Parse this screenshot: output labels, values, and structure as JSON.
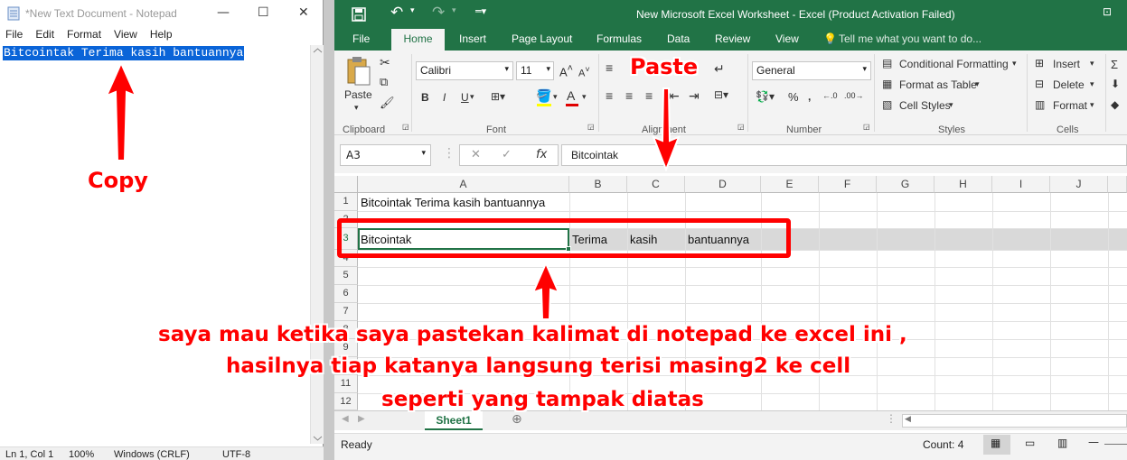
{
  "notepad": {
    "title": "*New Text Document - Notepad",
    "menu": [
      "File",
      "Edit",
      "Format",
      "View",
      "Help"
    ],
    "content": "Bitcointak Terima kasih bantuannya",
    "status": {
      "position": "Ln 1, Col 1",
      "zoom": "100%",
      "line_ending": "Windows (CRLF)",
      "encoding": "UTF-8"
    }
  },
  "excel": {
    "title": "New Microsoft Excel Worksheet - Excel (Product Activation Failed)",
    "tabs": [
      "File",
      "Home",
      "Insert",
      "Page Layout",
      "Formulas",
      "Data",
      "Review",
      "View"
    ],
    "tell_me": "Tell me what you want to do...",
    "ribbon": {
      "paste": "Paste",
      "font_name": "Calibri",
      "font_size": "11",
      "number_format": "General",
      "conditional_formatting": "Conditional Formatting",
      "format_as_table": "Format as Table",
      "cell_styles": "Cell Styles",
      "insert": "Insert",
      "delete": "Delete",
      "format": "Format",
      "groups": {
        "clipboard": "Clipboard",
        "font": "Font",
        "alignment": "Alignment",
        "number": "Number",
        "styles": "Styles",
        "cells": "Cells"
      }
    },
    "name_box": "A3",
    "formula": "Bitcointak",
    "columns": [
      "A",
      "B",
      "C",
      "D",
      "E",
      "F",
      "G",
      "H",
      "I",
      "J"
    ],
    "rows": [
      "1",
      "2",
      "3",
      "4",
      "5",
      "6",
      "7",
      "8",
      "9",
      "10",
      "11",
      "12"
    ],
    "cells": {
      "A1": "Bitcointak Terima kasih bantuannya",
      "A3": "Bitcointak",
      "B3": "Terima",
      "C3": "kasih",
      "D3": "bantuannya"
    },
    "sheet_tab": "Sheet1",
    "status": {
      "ready": "Ready",
      "count": "Count: 4"
    }
  },
  "annotations": {
    "copy": "Copy",
    "paste": "Paste",
    "line1": "saya mau ketika saya pastekan kalimat di notepad ke excel ini ,",
    "line2": "hasilnya tiap katanya langsung terisi masing2 ke cell",
    "line3": "seperti yang tampak diatas",
    "color": "#ff0000"
  }
}
